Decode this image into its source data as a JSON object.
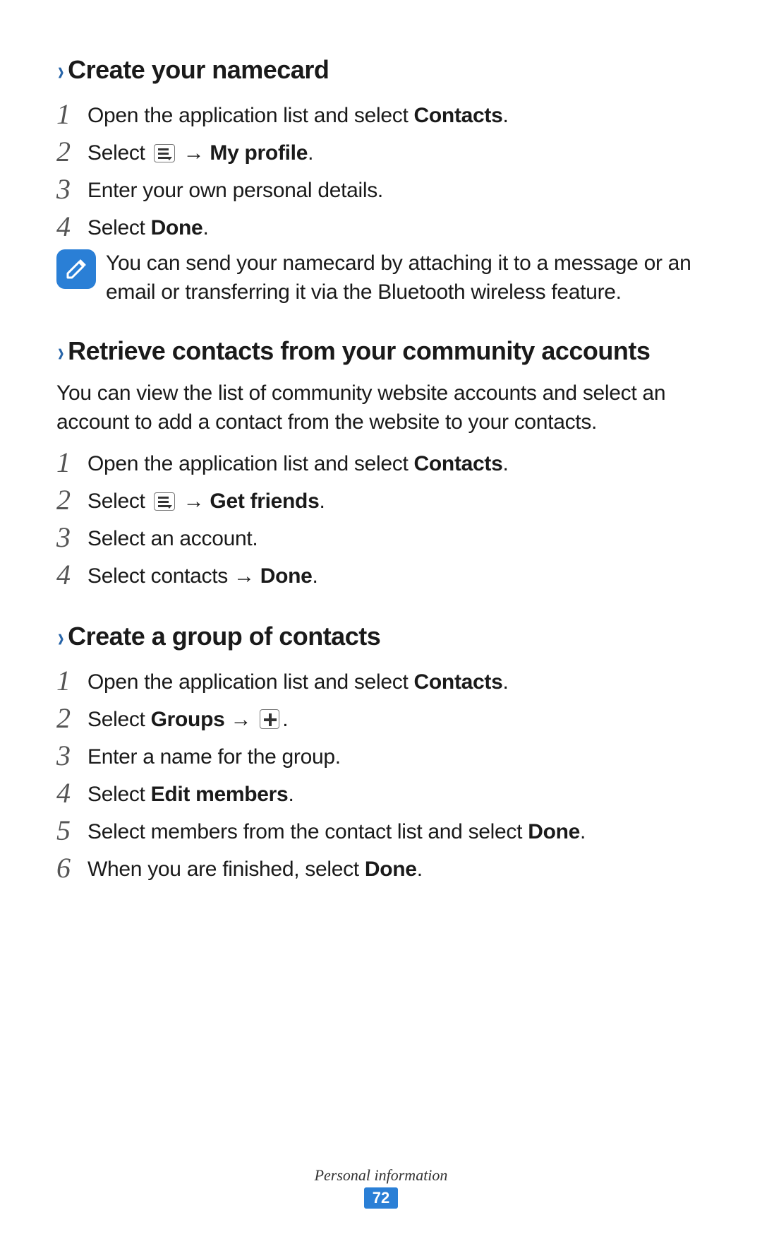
{
  "section1": {
    "title": "Create your namecard",
    "steps": [
      {
        "n": "1",
        "pre": "Open the application list and select ",
        "bold": "Contacts",
        "post": "."
      },
      {
        "n": "2",
        "pre": "Select ",
        "icon": "menu",
        "arrow": " → ",
        "bold": "My profile",
        "post": "."
      },
      {
        "n": "3",
        "pre": "Enter your own personal details."
      },
      {
        "n": "4",
        "pre": "Select ",
        "bold": "Done",
        "post": "."
      }
    ],
    "note": "You can send your namecard by attaching it to a message or an email or transferring it via the Bluetooth wireless feature."
  },
  "section2": {
    "title": "Retrieve contacts from your community accounts",
    "intro": "You can view the list of community website accounts and select an account to add a contact from the website to your contacts.",
    "steps": [
      {
        "n": "1",
        "pre": "Open the application list and select ",
        "bold": "Contacts",
        "post": "."
      },
      {
        "n": "2",
        "pre": "Select ",
        "icon": "menu",
        "arrow": " → ",
        "bold": "Get friends",
        "post": "."
      },
      {
        "n": "3",
        "pre": "Select an account."
      },
      {
        "n": "4",
        "pre": "Select contacts → ",
        "bold": "Done",
        "post": "."
      }
    ]
  },
  "section3": {
    "title": "Create a group of contacts",
    "steps": [
      {
        "n": "1",
        "pre": "Open the application list and select ",
        "bold": "Contacts",
        "post": "."
      },
      {
        "n": "2",
        "pre": "Select ",
        "bold": "Groups",
        "arrow": " → ",
        "icon": "plus",
        "post": "."
      },
      {
        "n": "3",
        "pre": "Enter a name for the group."
      },
      {
        "n": "4",
        "pre": "Select ",
        "bold": "Edit members",
        "post": "."
      },
      {
        "n": "5",
        "pre": "Select members from the contact list and select ",
        "bold": "Done",
        "post": "."
      },
      {
        "n": "6",
        "pre": "When you are finished, select ",
        "bold": "Done",
        "post": "."
      }
    ]
  },
  "footer": {
    "label": "Personal information",
    "page": "72"
  }
}
